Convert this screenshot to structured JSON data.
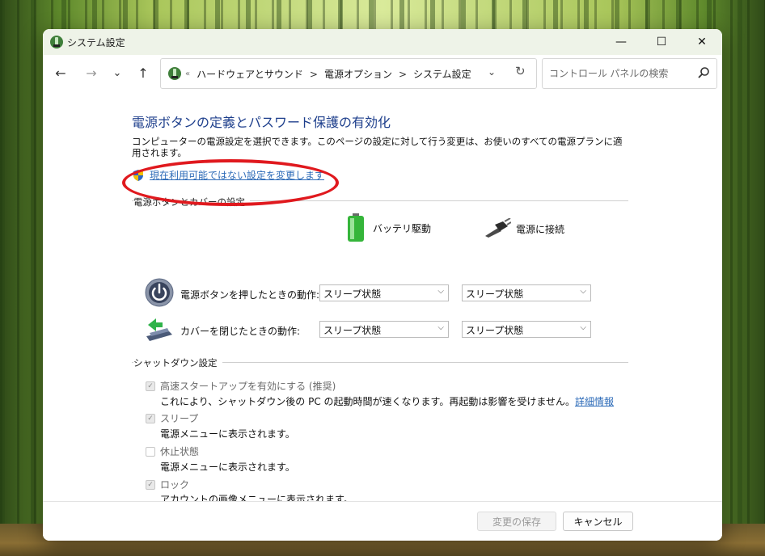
{
  "window": {
    "title": "システム設定",
    "controls": {
      "minimize": "—",
      "maximize": "☐",
      "close": "✕"
    }
  },
  "nav": {
    "back": "←",
    "forward": "→",
    "recent": "⌄",
    "up": "↑",
    "breadcrumbs": [
      "ハードウェアとサウンド",
      "電源オプション",
      "システム設定"
    ],
    "overflow": "«",
    "separator": ">",
    "dropdown": "⌄",
    "refresh": "↻",
    "search_placeholder": "コントロール パネルの検索"
  },
  "main": {
    "heading": "電源ボタンの定義とパスワード保護の有効化",
    "description": "コンピューターの電源設定を選択できます。このページの設定に対して行う変更は、お使いのすべての電源プランに適用されます。",
    "admin_link": "現在利用可能ではない設定を変更します",
    "power_section_title": "電源ボタンとカバーの設定",
    "columns": {
      "battery": "バッテリ駆動",
      "plugged": "電源に接続"
    },
    "rows": [
      {
        "label": "電源ボタンを押したときの動作:",
        "battery_value": "スリープ状態",
        "plugged_value": "スリープ状態"
      },
      {
        "label": "カバーを閉じたときの動作:",
        "battery_value": "スリープ状態",
        "plugged_value": "スリープ状態"
      }
    ],
    "shutdown_section_title": "シャットダウン設定",
    "shutdown_options": [
      {
        "label": "高速スタートアップを有効にする (推奨)",
        "desc": "これにより、シャットダウン後の PC の起動時間が速くなります。再起動は影響を受けません。",
        "link": "詳細情報",
        "checked": true
      },
      {
        "label": "スリープ",
        "desc": "電源メニューに表示されます。",
        "checked": true
      },
      {
        "label": "休止状態",
        "desc": "電源メニューに表示されます。",
        "checked": false
      },
      {
        "label": "ロック",
        "desc": "アカウントの画像メニューに表示されます。",
        "checked": true
      }
    ],
    "annotation_color": "#e0191e"
  },
  "footer": {
    "save": "変更の保存",
    "cancel": "キャンセル"
  }
}
